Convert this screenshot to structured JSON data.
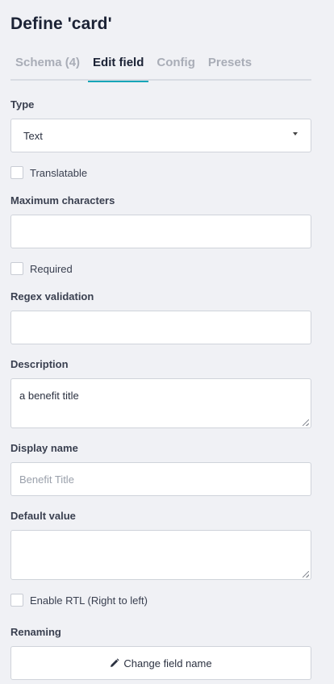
{
  "header": {
    "title": "Define 'card'"
  },
  "tabs": [
    {
      "label": "Schema (4)",
      "active": false
    },
    {
      "label": "Edit field",
      "active": true
    },
    {
      "label": "Config",
      "active": false
    },
    {
      "label": "Presets",
      "active": false
    }
  ],
  "form": {
    "type": {
      "label": "Type",
      "value": "Text"
    },
    "translatable": {
      "label": "Translatable",
      "checked": false
    },
    "max_chars": {
      "label": "Maximum characters",
      "value": ""
    },
    "required": {
      "label": "Required",
      "checked": false
    },
    "regex": {
      "label": "Regex validation",
      "value": ""
    },
    "description": {
      "label": "Description",
      "value": "a benefit title"
    },
    "display_name": {
      "label": "Display name",
      "placeholder": "Benefit Title"
    },
    "default_value": {
      "label": "Default value",
      "value": ""
    },
    "rtl": {
      "label": "Enable RTL (Right to left)",
      "checked": false
    },
    "renaming": {
      "label": "Renaming",
      "button_label": "Change field name",
      "button_icon": "pencil-icon"
    }
  },
  "colors": {
    "accent": "#17a6b8",
    "background": "#f0f1f5"
  }
}
